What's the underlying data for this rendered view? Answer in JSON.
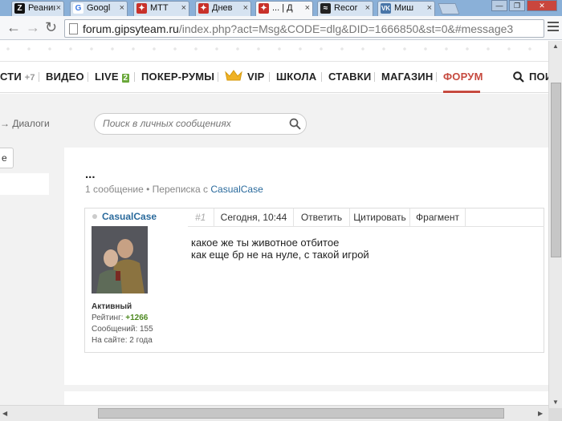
{
  "browser": {
    "tabs": [
      {
        "label": "Реаниı",
        "favicon_text": "Z",
        "favicon_color": "#111111"
      },
      {
        "label": "Googl",
        "favicon_text": "G",
        "favicon_color": "#3c7ae4"
      },
      {
        "label": "MTT",
        "favicon_text": "✦",
        "favicon_color": "#c8312a"
      },
      {
        "label": "Днев",
        "favicon_text": "✦",
        "favicon_color": "#c8312a"
      },
      {
        "label": "... | Д",
        "favicon_text": "✦",
        "favicon_color": "#c8312a"
      },
      {
        "label": "Recor",
        "favicon_text": "≈",
        "favicon_color": "#222222"
      },
      {
        "label": "Миш",
        "favicon_text": "VK",
        "favicon_color": "#4a76a8"
      }
    ],
    "tab_close_glyph": "×",
    "url_host": "forum.gipsyteam.ru",
    "url_rest": "/index.php?act=Msg&CODE=dlg&DID=1666850&st=0&#message3"
  },
  "site_nav": {
    "items": [
      {
        "label": "СТИ",
        "badge": "+7"
      },
      {
        "label": "ВИДЕО"
      },
      {
        "label": "LIVE",
        "badge_green": "2"
      },
      {
        "label": "ПОКЕР-РУМЫ"
      },
      {
        "label": "VIP"
      },
      {
        "label": "ШКОЛА"
      },
      {
        "label": "СТАВКИ"
      },
      {
        "label": "МАГАЗИН"
      },
      {
        "label": "ФОРУМ"
      },
      {
        "label": "ПОИ"
      }
    ],
    "accent_color": "#c64a3f"
  },
  "breadcrumb": "→ Диалоги",
  "search": {
    "placeholder": "Поиск в личных сообщениях"
  },
  "left_button_label": "е",
  "dialog": {
    "title": "...",
    "message_count": "1 сообщение",
    "separator": "•",
    "conversation_with_prefix": "Переписка с",
    "conversation_with_user": "CasualCase"
  },
  "post": {
    "author": "CasualCase",
    "status": "Активный",
    "rating_label": "Рейтинг:",
    "rating_value": "+1266",
    "messages_label": "Сообщений: 155",
    "on_site_label": "На сайте: 2 года",
    "number": "#1",
    "date": "Сегодня, 10:44",
    "actions": [
      "Ответить",
      "Цитировать",
      "Фрагмент"
    ],
    "text_lines": [
      "какое же ты животное отбитое",
      "как еще бр не на нуле, с такой игрой"
    ]
  }
}
